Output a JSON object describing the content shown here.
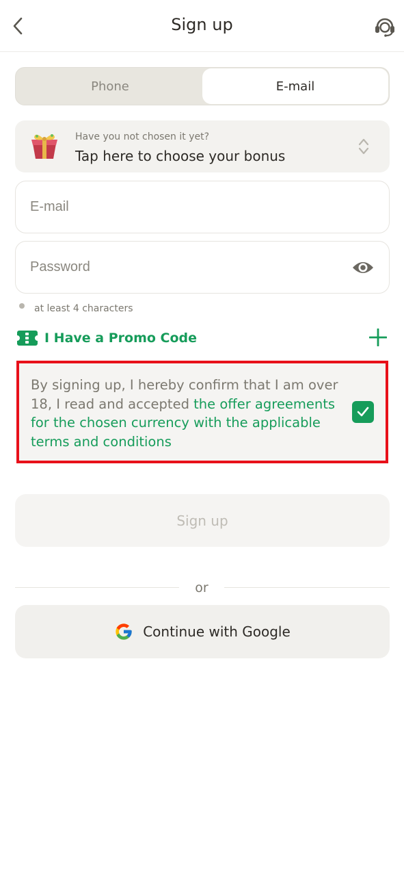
{
  "header": {
    "title": "Sign up",
    "back_icon": "chevron-left-icon",
    "support_icon": "headset-icon"
  },
  "tabs": [
    {
      "label": "Phone",
      "active": false
    },
    {
      "label": "E-mail",
      "active": true
    }
  ],
  "bonus": {
    "hint": "Have you not chosen it yet?",
    "label": "Tap here to choose your bonus",
    "icon": "gift-box-icon"
  },
  "fields": {
    "email_placeholder": "E-mail",
    "email_value": "",
    "password_placeholder": "Password",
    "password_value": ""
  },
  "password_hint": "at least 4 characters",
  "promo": {
    "label": "I Have a Promo Code",
    "icon": "ticket-icon"
  },
  "terms": {
    "text": "By signing up, I hereby confirm that I am over 18, I read and accepted ",
    "link": "the offer agreements for the chosen currency with the applicable terms and conditions",
    "checked": true
  },
  "signup_button": "Sign up",
  "or_label": "or",
  "google_button": "Continue with Google",
  "colors": {
    "accent": "#169c5a",
    "highlight_border": "#e8101a"
  }
}
